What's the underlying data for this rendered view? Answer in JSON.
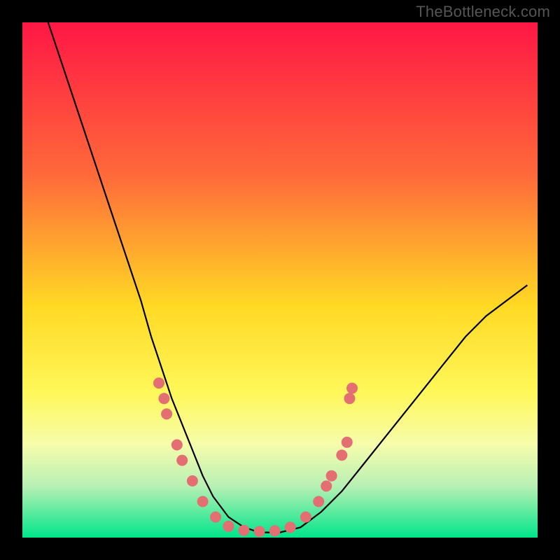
{
  "watermark": "TheBottleneck.com",
  "chart_data": {
    "type": "line",
    "title": "",
    "xlabel": "",
    "ylabel": "",
    "xlim": [
      0,
      100
    ],
    "ylim": [
      0,
      100
    ],
    "grid": false,
    "legend": false,
    "background_gradient": {
      "stops": [
        {
          "offset": 0.0,
          "color": "#ff1745"
        },
        {
          "offset": 0.3,
          "color": "#ff6b3a"
        },
        {
          "offset": 0.55,
          "color": "#ffd924"
        },
        {
          "offset": 0.72,
          "color": "#fff85a"
        },
        {
          "offset": 0.82,
          "color": "#f6fcac"
        },
        {
          "offset": 0.9,
          "color": "#b8f0b4"
        },
        {
          "offset": 1.0,
          "color": "#00e58a"
        }
      ]
    },
    "series": [
      {
        "name": "curve",
        "color": "#000000",
        "x": [
          5,
          8,
          11,
          14,
          17,
          20,
          23,
          25,
          27,
          29,
          31,
          33,
          35,
          37,
          40,
          43,
          46,
          50,
          54,
          58,
          62,
          66,
          70,
          74,
          78,
          82,
          86,
          90,
          94,
          98
        ],
        "y": [
          100,
          91,
          82,
          73,
          64,
          55,
          46,
          39,
          33,
          27,
          22,
          17,
          12,
          8,
          4,
          2,
          1,
          1,
          2,
          5,
          9,
          14,
          19,
          24,
          29,
          34,
          39,
          43,
          46,
          49
        ]
      }
    ],
    "markers": {
      "name": "dots",
      "color": "#e46f73",
      "radius": 8,
      "points": [
        {
          "x": 26.5,
          "y": 30
        },
        {
          "x": 27.5,
          "y": 27
        },
        {
          "x": 28,
          "y": 24
        },
        {
          "x": 30,
          "y": 18
        },
        {
          "x": 31,
          "y": 15
        },
        {
          "x": 33,
          "y": 11
        },
        {
          "x": 35,
          "y": 7
        },
        {
          "x": 37.5,
          "y": 4
        },
        {
          "x": 40,
          "y": 2.2
        },
        {
          "x": 43,
          "y": 1.4
        },
        {
          "x": 46,
          "y": 1.2
        },
        {
          "x": 49,
          "y": 1.3
        },
        {
          "x": 52,
          "y": 2.0
        },
        {
          "x": 55,
          "y": 4
        },
        {
          "x": 57.5,
          "y": 7
        },
        {
          "x": 59,
          "y": 10
        },
        {
          "x": 60,
          "y": 12
        },
        {
          "x": 62,
          "y": 16
        },
        {
          "x": 63,
          "y": 18.5
        },
        {
          "x": 63.5,
          "y": 27
        },
        {
          "x": 64,
          "y": 29
        }
      ]
    }
  }
}
